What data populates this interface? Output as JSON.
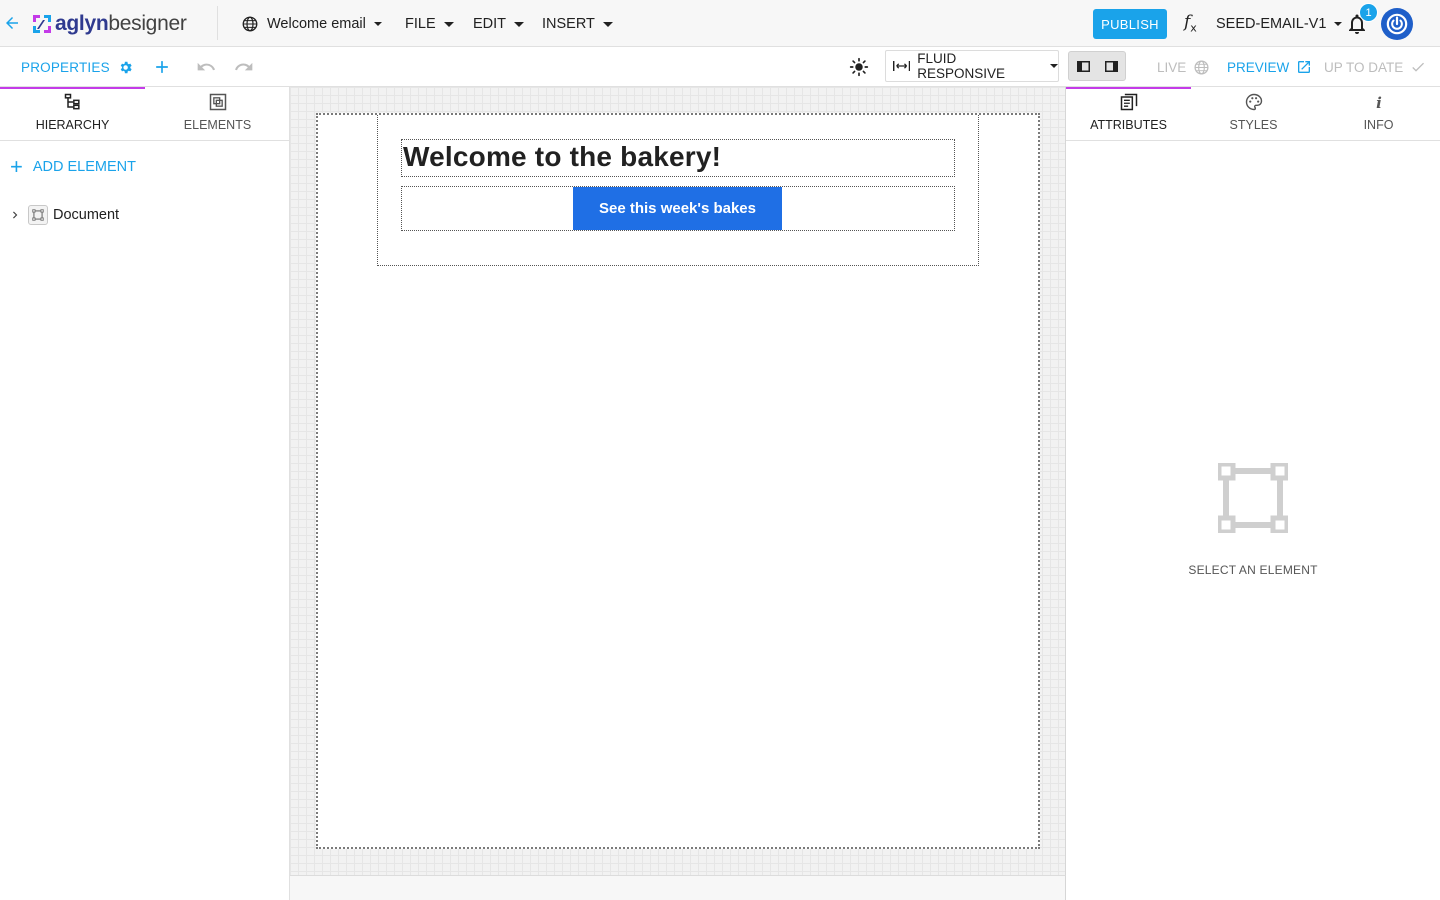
{
  "header": {
    "brand_bold": "aglyn",
    "brand_rest": "besigner",
    "document_name": "Welcome email",
    "menus": [
      "FILE",
      "EDIT",
      "INSERT"
    ],
    "publish_label": "PUBLISH",
    "fx_symbol": "f",
    "fx_sub": "x",
    "version_name": "SEED-EMAIL-V1",
    "notification_count": "1"
  },
  "toolbar": {
    "properties_label": "PROPERTIES",
    "viewport_mode": "FLUID RESPONSIVE",
    "live_label": "LIVE",
    "preview_label": "PREVIEW",
    "status_label": "UP TO DATE"
  },
  "left_panel": {
    "tabs": [
      {
        "label": "HIERARCHY",
        "icon": "hierarchy-icon",
        "active": true
      },
      {
        "label": "ELEMENTS",
        "icon": "elements-icon",
        "active": false
      }
    ],
    "add_element_label": "ADD ELEMENT",
    "tree": [
      {
        "label": "Document",
        "icon": "document-node-icon",
        "expanded": false
      }
    ]
  },
  "canvas": {
    "heading_text": "Welcome to the bakery!",
    "button_text": "See this week's bakes"
  },
  "right_panel": {
    "tabs": [
      {
        "label": "ATTRIBUTES",
        "icon": "attributes-icon",
        "active": true
      },
      {
        "label": "STYLES",
        "icon": "palette-icon",
        "active": false
      },
      {
        "label": "INFO",
        "icon": "info-icon",
        "active": false
      }
    ],
    "empty_state_label": "SELECT AN ELEMENT"
  },
  "colors": {
    "accent": "#1aa3ea",
    "tab_indicator": "#c43be8",
    "cta_button": "#1f6fe5",
    "avatar": "#1f5fc9"
  }
}
